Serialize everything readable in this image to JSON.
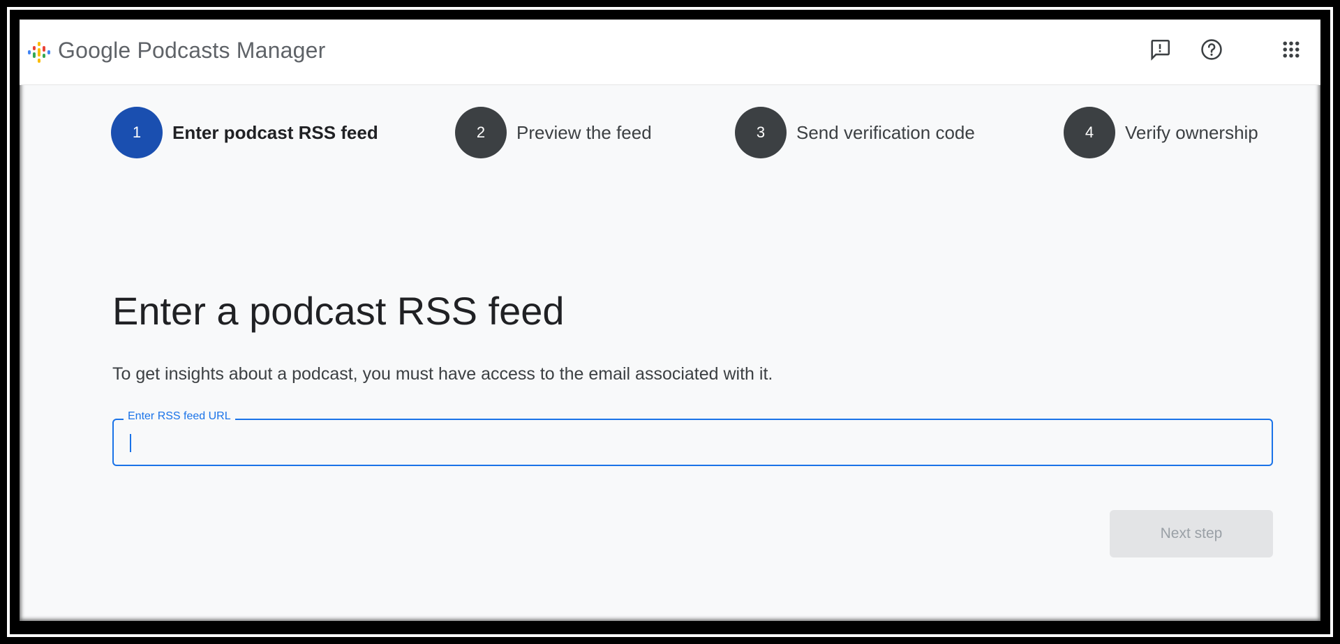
{
  "header": {
    "brand": "Google Podcasts Manager",
    "logo_icon": "google-podcasts-logo-icon",
    "icons": [
      "feedback-icon",
      "help-icon",
      "apps-grid-icon"
    ]
  },
  "stepper": {
    "steps": [
      {
        "number": "1",
        "label": "Enter podcast RSS feed",
        "active": true
      },
      {
        "number": "2",
        "label": "Preview the feed",
        "active": false
      },
      {
        "number": "3",
        "label": "Send verification code",
        "active": false
      },
      {
        "number": "4",
        "label": "Verify ownership",
        "active": false
      }
    ]
  },
  "main": {
    "title": "Enter a podcast RSS feed",
    "description": "To get insights about a podcast, you must have access to the email associated with it.",
    "rss_field": {
      "label": "Enter RSS feed URL",
      "value": ""
    },
    "next_button": "Next step"
  },
  "colors": {
    "accent": "#1a73e8",
    "active_step": "#1a4fb0",
    "inactive_step": "#3c4043",
    "disabled_button_bg": "#e3e4e6",
    "disabled_button_text": "#9aa0a6"
  }
}
